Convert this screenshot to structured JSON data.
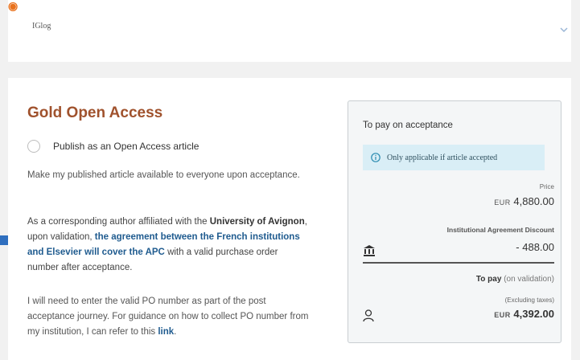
{
  "top_panel": {
    "journal_name": "IGlog"
  },
  "section": {
    "title": "Gold Open Access",
    "radio_label": "Publish as an Open Access article",
    "p1": "Make my published article available to everyone upon acceptance.",
    "p2_a": "As a corresponding author affiliated with the ",
    "p2_b": "University of Avignon",
    "p2_c": ", upon validation, ",
    "p2_d": "the agreement between the French institutions and Elsevier will cover the APC",
    "p2_e": " with a valid purchase order number after acceptance.",
    "p3_a": "I will need to enter the valid PO number as part of the post acceptance journey. For guidance on how to collect PO number from my institution, I can refer to this ",
    "p3_link": "link",
    "p3_end": "."
  },
  "pay_card": {
    "title": "To pay on acceptance",
    "info": "Only applicable if article accepted",
    "price_label": "Price",
    "currency": "EUR",
    "price": "4,880.00",
    "discount_label": "Institutional Agreement Discount",
    "discount": "- 488.00",
    "to_pay_label": "To pay",
    "to_pay_hint": "(on validation)",
    "excl_label": "(Excluding taxes)",
    "total": "4,392.00"
  },
  "colors": {
    "title": "#a0522d",
    "link": "#1f5b8f",
    "info_bg": "#d9eef6",
    "accent_arrow": "#2f6fbf",
    "corner_mark": "#e9711c"
  },
  "icons": [
    "chevron-down-icon",
    "info-icon",
    "bank-icon",
    "user-icon",
    "arrow-right-icon"
  ]
}
